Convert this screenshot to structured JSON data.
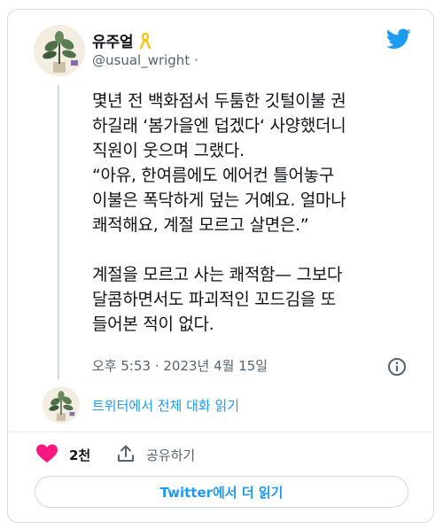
{
  "tweet": {
    "display_name": "유주얼",
    "handle": "@usual_wright ·",
    "text": "몇년 전 백화점서 두툼한 깃털이불 권\n하길래 ‘봄가을엔 덥겠다‘ 사양했더니\n직원이 웃으며 그랬다.\n“아유, 한여름에도 에어컨 틀어놓구\n이불은 폭닥하게 덮는 거예요. 얼마나\n쾌적해요, 계절 모르고 살면은.”\n\n계절을 모르고 사는 쾌적함— 그보다\n달콤하면서도 파괴적인 꼬드김을 또\n들어본 적이 없다.",
    "timestamp": "오후 5:53 · 2023년 4월 15일"
  },
  "thread": {
    "read_label": "트위터에서 전체 대화 읽기"
  },
  "actions": {
    "likes": "2천",
    "share_label": "공유하기",
    "read_more_label": "Twitter에서 더 읽기"
  },
  "icons": {
    "brand": "twitter-bird-icon",
    "badge": "yellow-ribbon-icon",
    "info": "info-icon",
    "like": "heart-icon",
    "share": "share-icon"
  },
  "colors": {
    "accent": "#1d9bf0",
    "like": "#f91880",
    "ribbon": "#f5c518",
    "text": "#0f1419",
    "muted": "#536471"
  }
}
